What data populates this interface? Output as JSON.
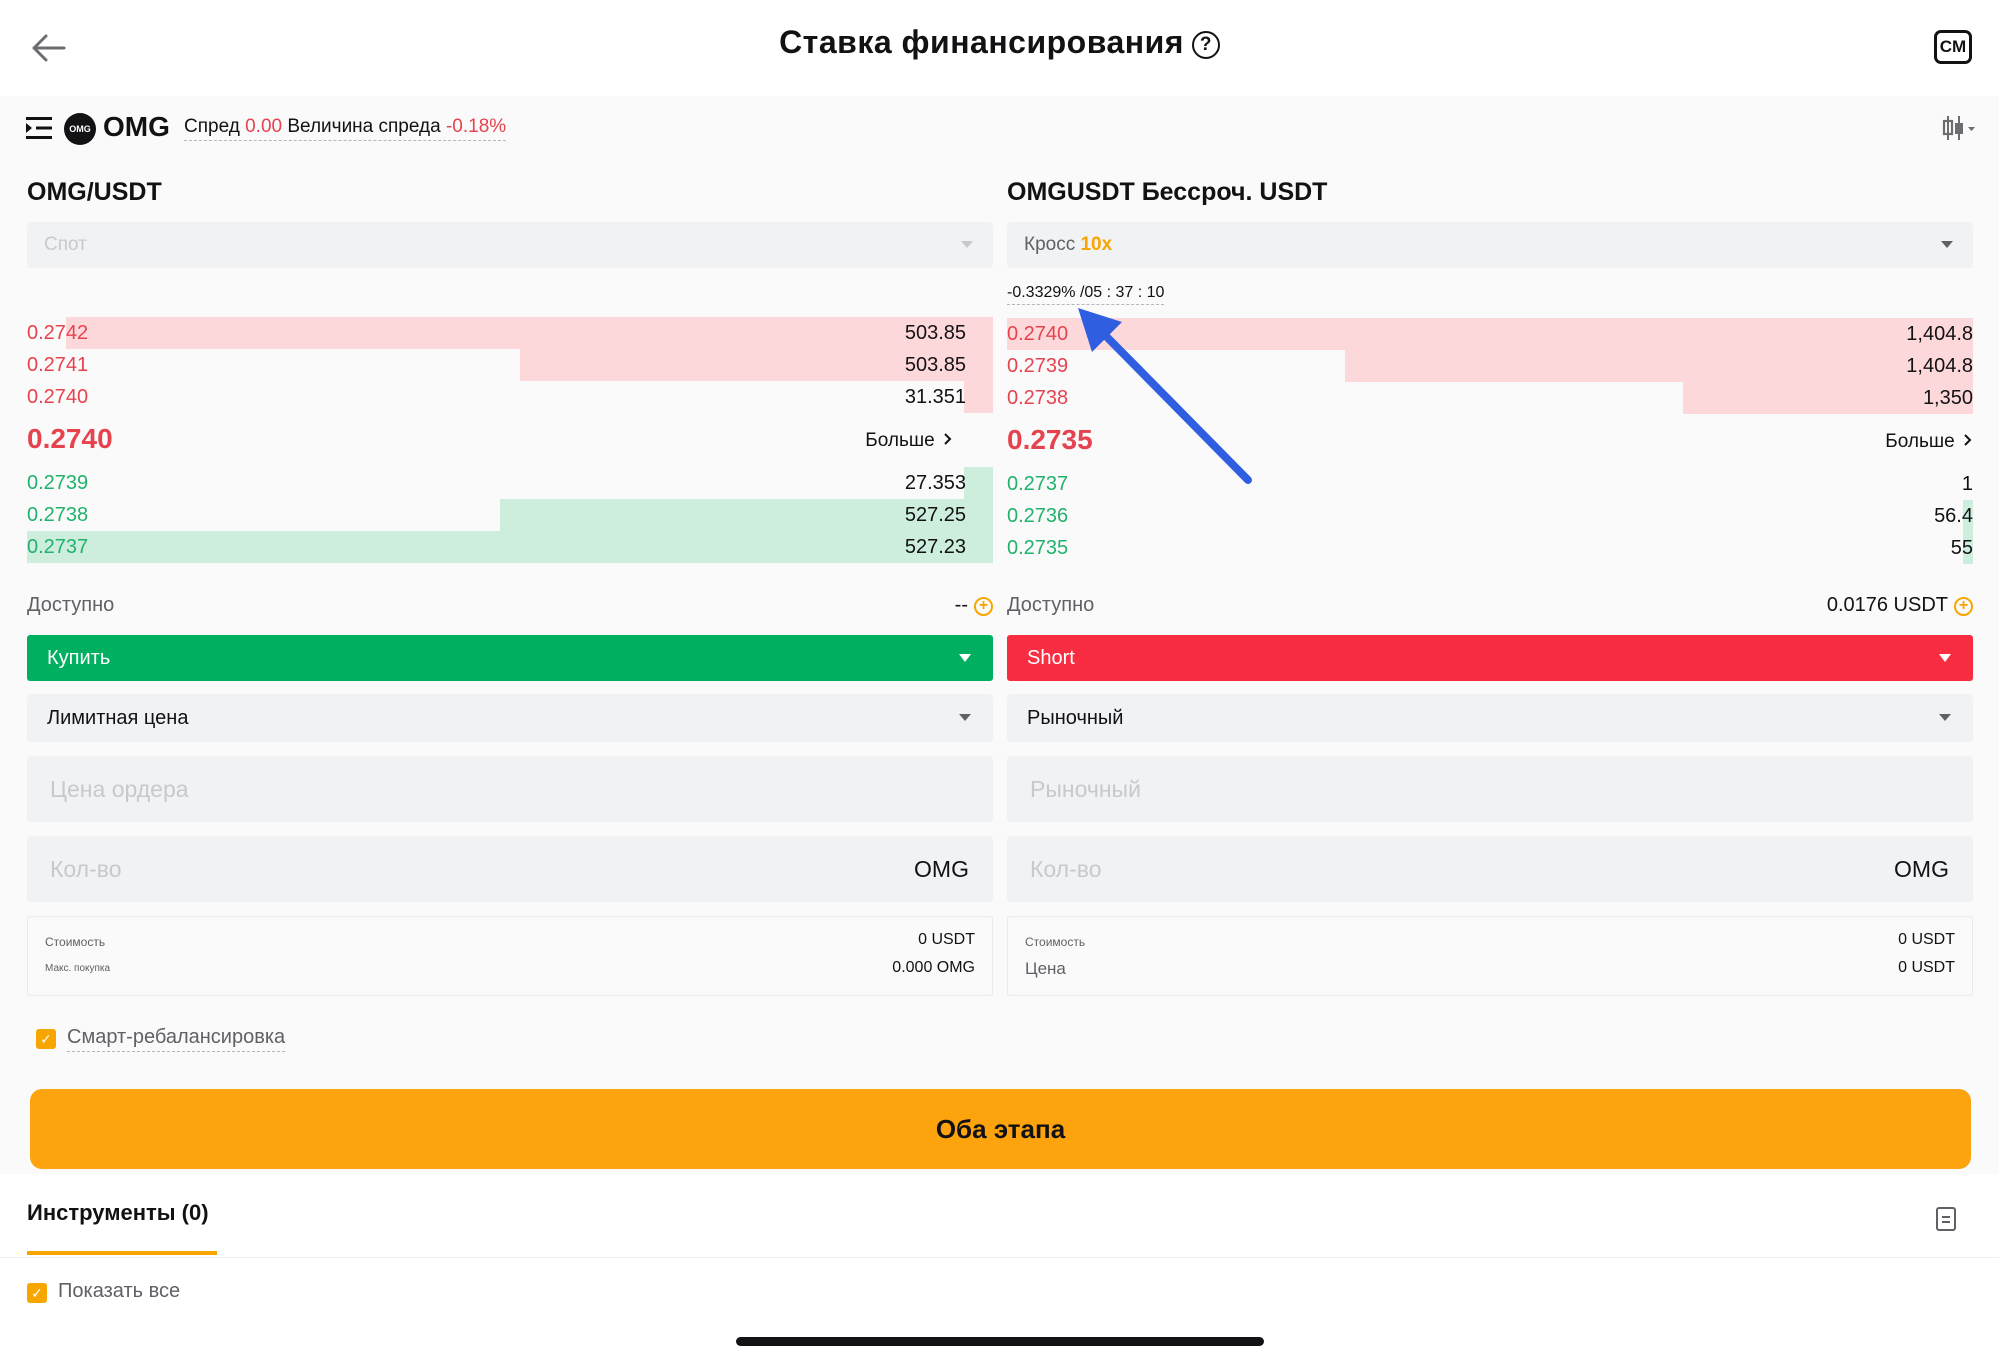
{
  "header": {
    "title": "Ставка финансирования",
    "help_icon": "?",
    "back_icon": "arrow-left-icon",
    "corner_badge": "CM"
  },
  "topbar": {
    "coin_logo_text": "OMG",
    "coin": "OMG",
    "spread_label": "Спред",
    "spread_value": "0.00",
    "spread_size_label": "Величина спреда",
    "spread_size_value": "-0.18%"
  },
  "left": {
    "title": "OMG/USDT",
    "market_select": "Спот",
    "asks": [
      {
        "price": "0.2742",
        "qty": "503.85",
        "depth": 0.96
      },
      {
        "price": "0.2741",
        "qty": "503.85",
        "depth": 0.49
      },
      {
        "price": "0.2740",
        "qty": "31.351",
        "depth": 0.03
      }
    ],
    "mid_price": "0.2740",
    "more_label": "Больше",
    "bids": [
      {
        "price": "0.2739",
        "qty": "27.353",
        "depth": 0.03
      },
      {
        "price": "0.2738",
        "qty": "527.25",
        "depth": 0.51
      },
      {
        "price": "0.2737",
        "qty": "527.23",
        "depth": 1.0
      }
    ],
    "available_label": "Доступно",
    "available_value": "--",
    "side_label": "Купить",
    "order_type": "Лимитная цена",
    "price_placeholder": "Цена ордера",
    "qty_placeholder": "Кол-во",
    "qty_unit": "OMG",
    "summary": [
      {
        "key": "Стоимость",
        "value": "0 USDT"
      },
      {
        "key": "Макс. покупка",
        "value": "0.000 OMG"
      }
    ]
  },
  "right": {
    "title": "OMGUSDT  Бессроч. USDT",
    "margin_mode": "Кросс",
    "leverage": "10x",
    "funding": "-0.3329% /05 : 37 : 10",
    "asks": [
      {
        "price": "0.2740",
        "qty": "1,404.8",
        "depth": 1.0
      },
      {
        "price": "0.2739",
        "qty": "1,404.8",
        "depth": 0.65
      },
      {
        "price": "0.2738",
        "qty": "1,350",
        "depth": 0.3
      }
    ],
    "mid_price": "0.2735",
    "more_label": "Больше",
    "bids": [
      {
        "price": "0.2737",
        "qty": "1",
        "depth": 0.0
      },
      {
        "price": "0.2736",
        "qty": "56.4",
        "depth": 0.01
      },
      {
        "price": "0.2735",
        "qty": "55",
        "depth": 0.01
      }
    ],
    "available_label": "Доступно",
    "available_value": "0.0176 USDT",
    "side_label": "Short",
    "order_type": "Рыночный",
    "price_placeholder": "Рыночный",
    "qty_placeholder": "Кол-во",
    "qty_unit": "OMG",
    "summary": [
      {
        "key": "Стоимость",
        "value": "0 USDT"
      },
      {
        "key": "Цена",
        "value": "0 USDT"
      }
    ]
  },
  "smart_rebalance_label": "Смарт-ребалансировка",
  "smart_rebalance_checked": true,
  "both_stages_button": "Оба этапа",
  "tabs": {
    "instruments_label": "Инструменты (0)",
    "show_all_label": "Показать все",
    "show_all_checked": true
  },
  "colors": {
    "accent": "#f7a600",
    "buy": "#00b060",
    "sell": "#f92d42",
    "ask_text": "#e6434f",
    "bid_text": "#20b26c",
    "annotation_arrow": "#2f5fe0"
  }
}
